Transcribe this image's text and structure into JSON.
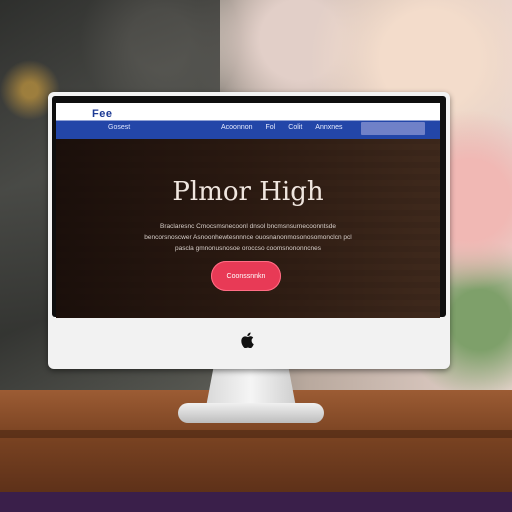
{
  "website": {
    "logo": "Fee",
    "sub_link": "Gosest",
    "nav": [
      "Acoonnon",
      "Fol",
      "Colit",
      "Annxnes"
    ],
    "hero": {
      "title": "Plmor High",
      "lines": [
        "Braclaresnc Cmocsmsnecoonl dnsol bncmsnsurnecoonntsde",
        "bencorsnoscwer Asnoonhewtesnnnce ouosnanonmosonosomonclcn pcl",
        "pascla gmnonusnosoe oroccso coomsnononncnes"
      ],
      "cta_label": "Coonssnnkn"
    }
  },
  "device": {
    "logo_icon": "apple-icon"
  }
}
